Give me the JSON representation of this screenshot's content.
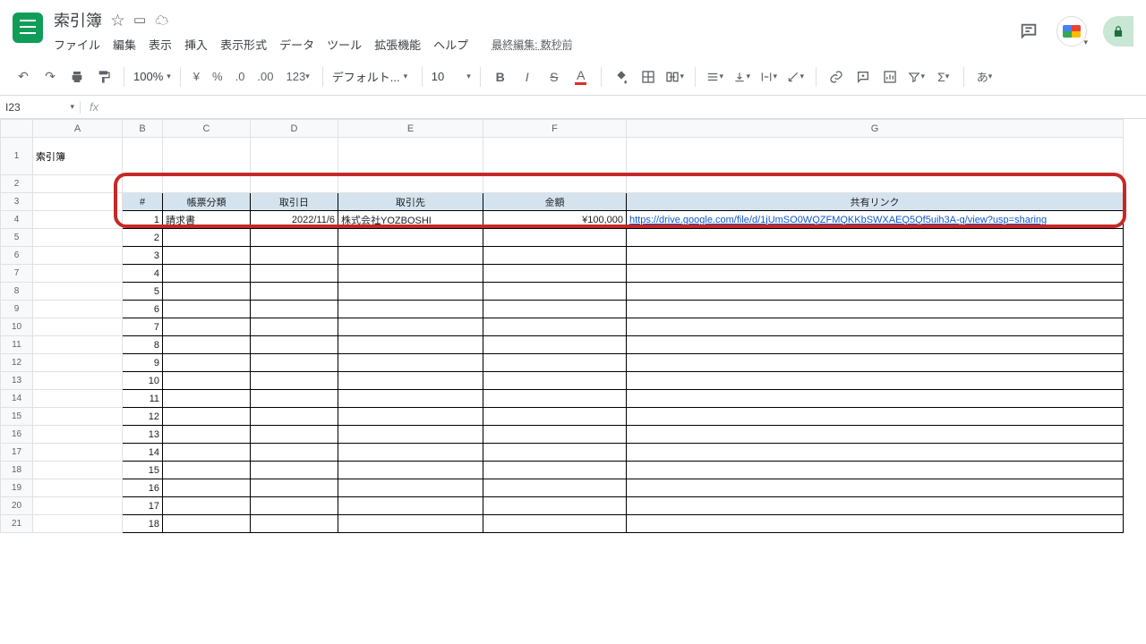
{
  "doc": {
    "title": "索引簿",
    "last_edit": "最終編集: 数秒前"
  },
  "menu": [
    "ファイル",
    "編集",
    "表示",
    "挿入",
    "表示形式",
    "データ",
    "ツール",
    "拡張機能",
    "ヘルプ"
  ],
  "toolbar": {
    "zoom": "100%",
    "fmt_currency": "¥",
    "fmt_percent": "%",
    "fmt_dec_dec": ".0",
    "fmt_dec_inc": ".00",
    "fmt_more": "123",
    "font": "デフォルト...",
    "size": "10",
    "input_ja": "あ"
  },
  "namebox": "I23",
  "columns": [
    "A",
    "B",
    "C",
    "D",
    "E",
    "F",
    "G"
  ],
  "a1_title": "索引簿",
  "table": {
    "headers": [
      "#",
      "帳票分類",
      "取引日",
      "取引先",
      "金額",
      "共有リンク"
    ],
    "rows": [
      {
        "n": "1",
        "cat": "請求書",
        "date": "2022/11/6",
        "partner": "株式会社YOZBOSHI",
        "amount": "¥100,000",
        "link": "https://drive.google.com/file/d/1jUmSO0WQZFMQKKbSWXAEQ5Qf5uih3A-g/view?usp=sharing"
      },
      {
        "n": "2",
        "cat": "",
        "date": "",
        "partner": "",
        "amount": "",
        "link": ""
      },
      {
        "n": "3",
        "cat": "",
        "date": "",
        "partner": "",
        "amount": "",
        "link": ""
      },
      {
        "n": "4",
        "cat": "",
        "date": "",
        "partner": "",
        "amount": "",
        "link": ""
      },
      {
        "n": "5",
        "cat": "",
        "date": "",
        "partner": "",
        "amount": "",
        "link": ""
      },
      {
        "n": "6",
        "cat": "",
        "date": "",
        "partner": "",
        "amount": "",
        "link": ""
      },
      {
        "n": "7",
        "cat": "",
        "date": "",
        "partner": "",
        "amount": "",
        "link": ""
      },
      {
        "n": "8",
        "cat": "",
        "date": "",
        "partner": "",
        "amount": "",
        "link": ""
      },
      {
        "n": "9",
        "cat": "",
        "date": "",
        "partner": "",
        "amount": "",
        "link": ""
      },
      {
        "n": "10",
        "cat": "",
        "date": "",
        "partner": "",
        "amount": "",
        "link": ""
      },
      {
        "n": "11",
        "cat": "",
        "date": "",
        "partner": "",
        "amount": "",
        "link": ""
      },
      {
        "n": "12",
        "cat": "",
        "date": "",
        "partner": "",
        "amount": "",
        "link": ""
      },
      {
        "n": "13",
        "cat": "",
        "date": "",
        "partner": "",
        "amount": "",
        "link": ""
      },
      {
        "n": "14",
        "cat": "",
        "date": "",
        "partner": "",
        "amount": "",
        "link": ""
      },
      {
        "n": "15",
        "cat": "",
        "date": "",
        "partner": "",
        "amount": "",
        "link": ""
      },
      {
        "n": "16",
        "cat": "",
        "date": "",
        "partner": "",
        "amount": "",
        "link": ""
      },
      {
        "n": "17",
        "cat": "",
        "date": "",
        "partner": "",
        "amount": "",
        "link": ""
      },
      {
        "n": "18",
        "cat": "",
        "date": "",
        "partner": "",
        "amount": "",
        "link": ""
      }
    ]
  },
  "col_widths": {
    "A": 100,
    "B": 45,
    "C": 98,
    "D": 98,
    "E": 162,
    "F": 160,
    "G": 555
  }
}
